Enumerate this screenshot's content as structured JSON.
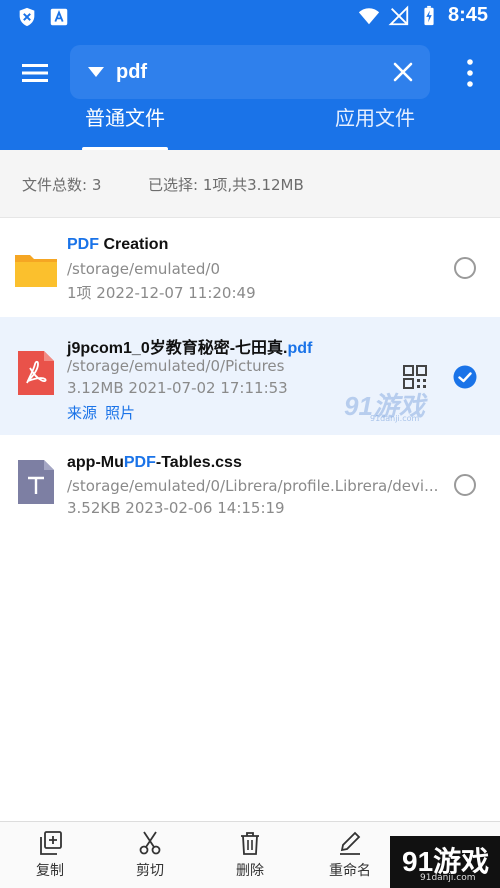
{
  "status_bar": {
    "time": "8:45"
  },
  "search": {
    "value": "pdf"
  },
  "tabs": [
    {
      "label": "普通文件",
      "active": true
    },
    {
      "label": "应用文件",
      "active": false
    }
  ],
  "summary": {
    "total": "文件总数: 3",
    "selected": "已选择: 1项,共3.12MB"
  },
  "files": [
    {
      "name_highlight": "PDF",
      "name_rest": " Creation",
      "path": "/storage/emulated/0",
      "meta": "1项  2022-12-07 11:20:49",
      "selected": false,
      "icon": "folder-icon"
    },
    {
      "name_main": "j9pcom1_0岁教育秘密-七田真.",
      "name_highlight": "pdf",
      "path": "/storage/emulated/0/Pictures",
      "meta": "3.12MB  2021-07-02 17:11:53",
      "links": [
        "来源",
        "照片"
      ],
      "selected": true,
      "icon": "pdf-file-icon"
    },
    {
      "name_pre": "app-Mu",
      "name_highlight": "PDF",
      "name_post": "-Tables.css",
      "path": "/storage/emulated/0/Librera/profile.Librera/devi...",
      "meta": "3.52KB  2023-02-06 14:15:19",
      "selected": false,
      "icon": "text-file-icon"
    }
  ],
  "bottom_bar": {
    "copy": "复制",
    "cut": "剪切",
    "delete": "删除",
    "rename": "重命名"
  },
  "watermark": {
    "brand": "91游戏",
    "site": "91danji.com"
  },
  "colors": {
    "primary": "#1a73e8",
    "selected_row": "#ecf3fd",
    "pdf_red": "#e9524a",
    "folder_yellow": "#fbc02d",
    "text_file_gray": "#7d7fa3"
  }
}
